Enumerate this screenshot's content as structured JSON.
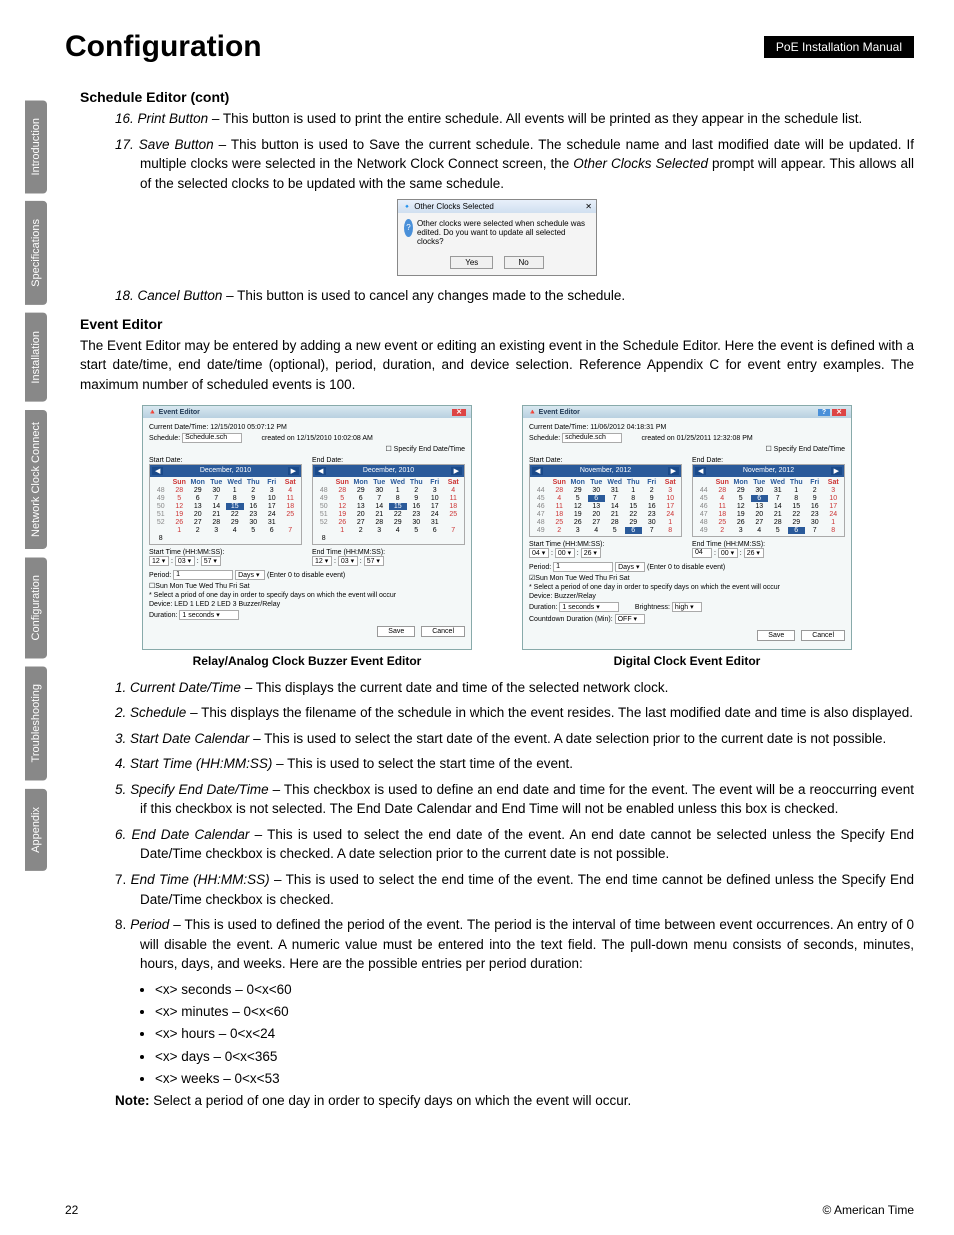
{
  "header": {
    "title": "Configuration",
    "badge": "PoE Installation Manual"
  },
  "side_tabs": [
    "Introduction",
    "Specifications",
    "Installation",
    "Network Clock\nConnect",
    "Configuration",
    "Troubleshooting",
    "Appendix"
  ],
  "sched_editor": {
    "subtitle": "Schedule Editor (cont)",
    "items": [
      {
        "n": "16.",
        "lbl": "Print Button",
        "txt": " – This button is used to print the entire schedule. All events will be printed as they appear in the schedule list."
      },
      {
        "n": "17.",
        "lbl": "Save Button",
        "txt": " – This button is used to Save the current schedule. The schedule name and last modified date will be updated. If multiple clocks were selected in the Network Clock Connect screen, the ",
        "tail_italic": "Other Clocks Selected",
        "tail": " prompt will appear. This allows all of the selected clocks to be updated with the same schedule."
      },
      {
        "n": "18.",
        "lbl": "Cancel Button",
        "txt": " – This button is used to cancel any changes made to the schedule."
      }
    ],
    "dialog": {
      "title": "Other Clocks Selected",
      "body": "Other clocks were selected when schedule was edited. Do you want to update all selected clocks?",
      "yes": "Yes",
      "no": "No"
    }
  },
  "event_editor": {
    "heading": "Event Editor",
    "intro": "The Event Editor may be entered by adding a new event or editing an existing event in the Schedule Editor. Here the event is defined with a start date/time, end date/time (optional), period, duration, and device selection. Reference Appendix C for event entry examples. The maximum number of scheduled events is 100.",
    "panel1": {
      "title": "Event Editor",
      "datetime": "Current Date/Time:  12/15/2010 05:07:12 PM",
      "schedule": "Schedule:",
      "schedule_val": "Schedule.sch",
      "created": "created on  12/15/2010 10:02:08 AM",
      "specify": "Specify End Date/Time",
      "start": "Start Date:",
      "end": "End Date:",
      "month": "December,  2010",
      "starttime": "Start Time (HH:MM:SS):",
      "endtime": "End Time (HH:MM:SS):",
      "period": "Period:",
      "period_val": "1",
      "period_unit": "Days",
      "period_note": "(Enter 0 to disable event)",
      "days": "Sun  Mon  Tue  Wed  Thu  Fri  Sat",
      "select_note": "*  Select a priod of one day in order to specify days on which the event will occur",
      "device": "Device:  LED 1   LED 2   LED 3   Buzzer/Relay",
      "duration": "Duration:",
      "duration_val": "1 seconds",
      "save": "Save",
      "cancel": "Cancel"
    },
    "panel2": {
      "title": "Event Editor",
      "datetime": "Current Date/Time:  11/06/2012 04:18:31 PM",
      "schedule": "Schedule:",
      "schedule_val": "schedule.sch",
      "created": "created on  01/25/2011 12:32:08 PM",
      "specify": "Specify End Date/Time",
      "start": "Start Date:",
      "end": "End Date:",
      "month": "November,  2012",
      "starttime": "Start Time (HH:MM:SS):",
      "endtime": "End Time (HH:MM:SS):",
      "period": "Period:",
      "period_val": "1",
      "period_unit": "Days",
      "period_note": "(Enter 0 to disable event)",
      "days": "Sun  Mon  Tue  Wed  Thu  Fri  Sat",
      "select_note": "*  Select a period of one day in order to specify days on which the event will occur",
      "device": "Device:  Buzzer/Relay",
      "duration": "Duration:",
      "duration_val": "1 seconds",
      "brightness": "Brightness:",
      "brightness_val": "high",
      "countdown": "Countdown Duration (Min):",
      "countdown_val": "OFF",
      "save": "Save",
      "cancel": "Cancel"
    },
    "caption1": "Relay/Analog Clock Buzzer Event Editor",
    "caption2": "Digital Clock Event Editor",
    "list": [
      {
        "n": "1.",
        "lbl": "Current Date/Time",
        "txt": " – This displays the current date and time of the selected network clock."
      },
      {
        "n": "2.",
        "lbl": "Schedule",
        "txt": " – This displays the filename of the schedule in which the event resides. The last modified date and time is also displayed."
      },
      {
        "n": "3.",
        "lbl": "Start Date Calendar",
        "txt": " – This is used to select the start date of the event. A date selection prior to the current date is not possible."
      },
      {
        "n": "4.",
        "lbl": "Start Time (HH:MM:SS)",
        "txt": " – This is used to select the start time of the event."
      },
      {
        "n": "5.",
        "lbl": "Specify End Date/Time",
        "txt": " – This checkbox is used to define an end date and time for the event. The event will be a reoccurring event if this checkbox is not selected. The End Date Calendar and End Time will not be enabled unless this box is checked."
      },
      {
        "n": "6.",
        "lbl": "End Date Calendar",
        "txt": " – This is used to select the end date of the event. An end date cannot be selected unless the Specify End Date/Time checkbox is checked. A date selection prior to the current date is not possible."
      },
      {
        "n": "7.",
        "n_plain": true,
        "lbl": "End Time (HH:MM:SS)",
        "txt": " – This is used to select the end time of the event. The end time cannot be defined  unless the Specify End Date/Time checkbox is checked."
      },
      {
        "n": "8.",
        "n_plain": true,
        "lbl": "Period",
        "txt": " – This is used to defined the period of the event. The period is the interval of time between event occurrences. An entry of 0 will disable the event. A numeric value must be entered into the text field. The pull-down menu consists of seconds, minutes, hours, days, and weeks. Here are the possible entries per period duration:"
      }
    ],
    "bullets": [
      "<x> seconds – 0<x<60",
      "<x> minutes – 0<x<60",
      "<x> hours – 0<x<24",
      "<x> days – 0<x<365",
      "<x> weeks – 0<x<53"
    ],
    "note_lbl": "Note:",
    "note_txt": " Select a period of one day in order to specify days on which the event will occur."
  },
  "footer": {
    "page": "22",
    "copyright": "© American Time"
  },
  "cal_a_rows": [
    [
      "",
      "Sun",
      "Mon",
      "Tue",
      "Wed",
      "Thu",
      "Fri",
      "Sat"
    ],
    [
      "48",
      "28",
      "29",
      "30",
      "1",
      "2",
      "3",
      "4"
    ],
    [
      "49",
      "5",
      "6",
      "7",
      "8",
      "9",
      "10",
      "11"
    ],
    [
      "50",
      "12",
      "13",
      "14",
      "15",
      "16",
      "17",
      "18"
    ],
    [
      "51",
      "19",
      "20",
      "21",
      "22",
      "23",
      "24",
      "25"
    ],
    [
      "52",
      "26",
      "27",
      "28",
      "29",
      "30",
      "31",
      ""
    ],
    [
      "",
      "1",
      "2",
      "3",
      "4",
      "5",
      "6",
      "7",
      "8"
    ]
  ],
  "cal_b_rows": [
    [
      "",
      "Sun",
      "Mon",
      "Tue",
      "Wed",
      "Thu",
      "Fri",
      "Sat"
    ],
    [
      "44",
      "28",
      "29",
      "30",
      "31",
      "1",
      "2",
      "3"
    ],
    [
      "45",
      "4",
      "5",
      "6",
      "7",
      "8",
      "9",
      "10"
    ],
    [
      "46",
      "11",
      "12",
      "13",
      "14",
      "15",
      "16",
      "17"
    ],
    [
      "47",
      "18",
      "19",
      "20",
      "21",
      "22",
      "23",
      "24"
    ],
    [
      "48",
      "25",
      "26",
      "27",
      "28",
      "29",
      "30",
      "1"
    ],
    [
      "49",
      "2",
      "3",
      "4",
      "5",
      "6",
      "7",
      "8"
    ]
  ]
}
